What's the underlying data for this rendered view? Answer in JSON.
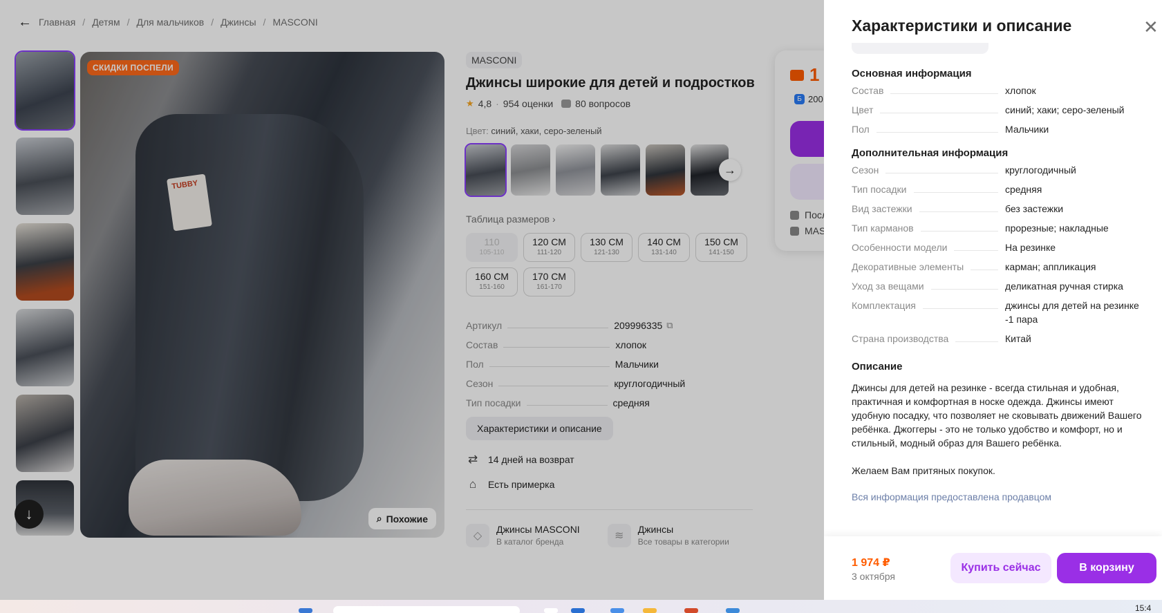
{
  "breadcrumbs": [
    "Главная",
    "Детям",
    "Для мальчиков",
    "Джинсы",
    "MASCONI"
  ],
  "gallery": {
    "sale_badge": "СКИДКИ ПОСПЕЛИ",
    "similar_label": "Похожие"
  },
  "product": {
    "brand": "MASCONI",
    "title": "Джинсы широкие для детей и подростков",
    "rating": "4,8",
    "reviews": "954 оценки",
    "questions": "80 вопросов",
    "color_label": "Цвет:",
    "color_value": "синий, хаки, серо-зеленый",
    "size_table_link": "Таблица размеров",
    "sizes": [
      {
        "label": "110",
        "range": "105-110",
        "disabled": true
      },
      {
        "label": "120 СМ",
        "range": "111-120"
      },
      {
        "label": "130 СМ",
        "range": "121-130"
      },
      {
        "label": "140 СМ",
        "range": "131-140"
      },
      {
        "label": "150 СМ",
        "range": "141-150"
      },
      {
        "label": "160 СМ",
        "range": "151-160"
      },
      {
        "label": "170 СМ",
        "range": "161-170"
      }
    ],
    "params": [
      {
        "k": "Артикул",
        "v": "209996335"
      },
      {
        "k": "Состав",
        "v": "хлопок"
      },
      {
        "k": "Пол",
        "v": "Мальчики"
      },
      {
        "k": "Сезон",
        "v": "круглогодичный"
      },
      {
        "k": "Тип посадки",
        "v": "средняя"
      }
    ],
    "char_button": "Характеристики и описание",
    "features": [
      "14 дней на возврат",
      "Есть примерка"
    ],
    "cards": [
      {
        "title": "Джинсы MASCONI",
        "sub": "В каталог бренда"
      },
      {
        "title": "Джинсы",
        "sub": "Все товары в категории"
      }
    ]
  },
  "buybox": {
    "price_partial": "1",
    "bonus_partial": "200",
    "line1": "Посл",
    "line2": "MAS"
  },
  "sheet": {
    "title": "Характеристики и описание",
    "main_title": "Основная информация",
    "main": [
      {
        "k": "Состав",
        "v": "хлопок"
      },
      {
        "k": "Цвет",
        "v": "синий; хаки; серо-зеленый"
      },
      {
        "k": "Пол",
        "v": "Мальчики"
      }
    ],
    "extra_title": "Дополнительная информация",
    "extra": [
      {
        "k": "Сезон",
        "v": "круглогодичный"
      },
      {
        "k": "Тип посадки",
        "v": "средняя"
      },
      {
        "k": "Вид застежки",
        "v": "без застежки"
      },
      {
        "k": "Тип карманов",
        "v": "прорезные; накладные"
      },
      {
        "k": "Особенности модели",
        "v": "На резинке"
      },
      {
        "k": "Декоративные элементы",
        "v": "карман; аппликация"
      },
      {
        "k": "Уход за вещами",
        "v": "деликатная ручная стирка"
      },
      {
        "k": "Комплектация",
        "v": "джинсы для детей на резинке -1 пара"
      },
      {
        "k": "Страна производства",
        "v": "Китай"
      }
    ],
    "desc_title": "Описание",
    "desc_p1": "Джинсы для детей на резинке - всегда стильная и удобная, практичная и комфортная в носке одежда. Джинсы имеют удобную посадку, что позволяет не сковывать движений Вашего ребёнка. Джоггеры - это не только удобство и комфорт, но и стильный, модный образ для Вашего ребёнка.",
    "desc_p2": "Желаем Вам притяных покупок.",
    "source_note": "Вся информация предоставлена продавцом",
    "footer": {
      "price": "1 974 ₽",
      "date": "3 октября",
      "buy_now": "Купить сейчас",
      "to_cart": "В корзину"
    }
  },
  "taskbar": {
    "time": "15:4"
  },
  "colors": {
    "accent": "#9a2fe6",
    "price": "#ff5c00",
    "sale": "#ff6a1a"
  }
}
